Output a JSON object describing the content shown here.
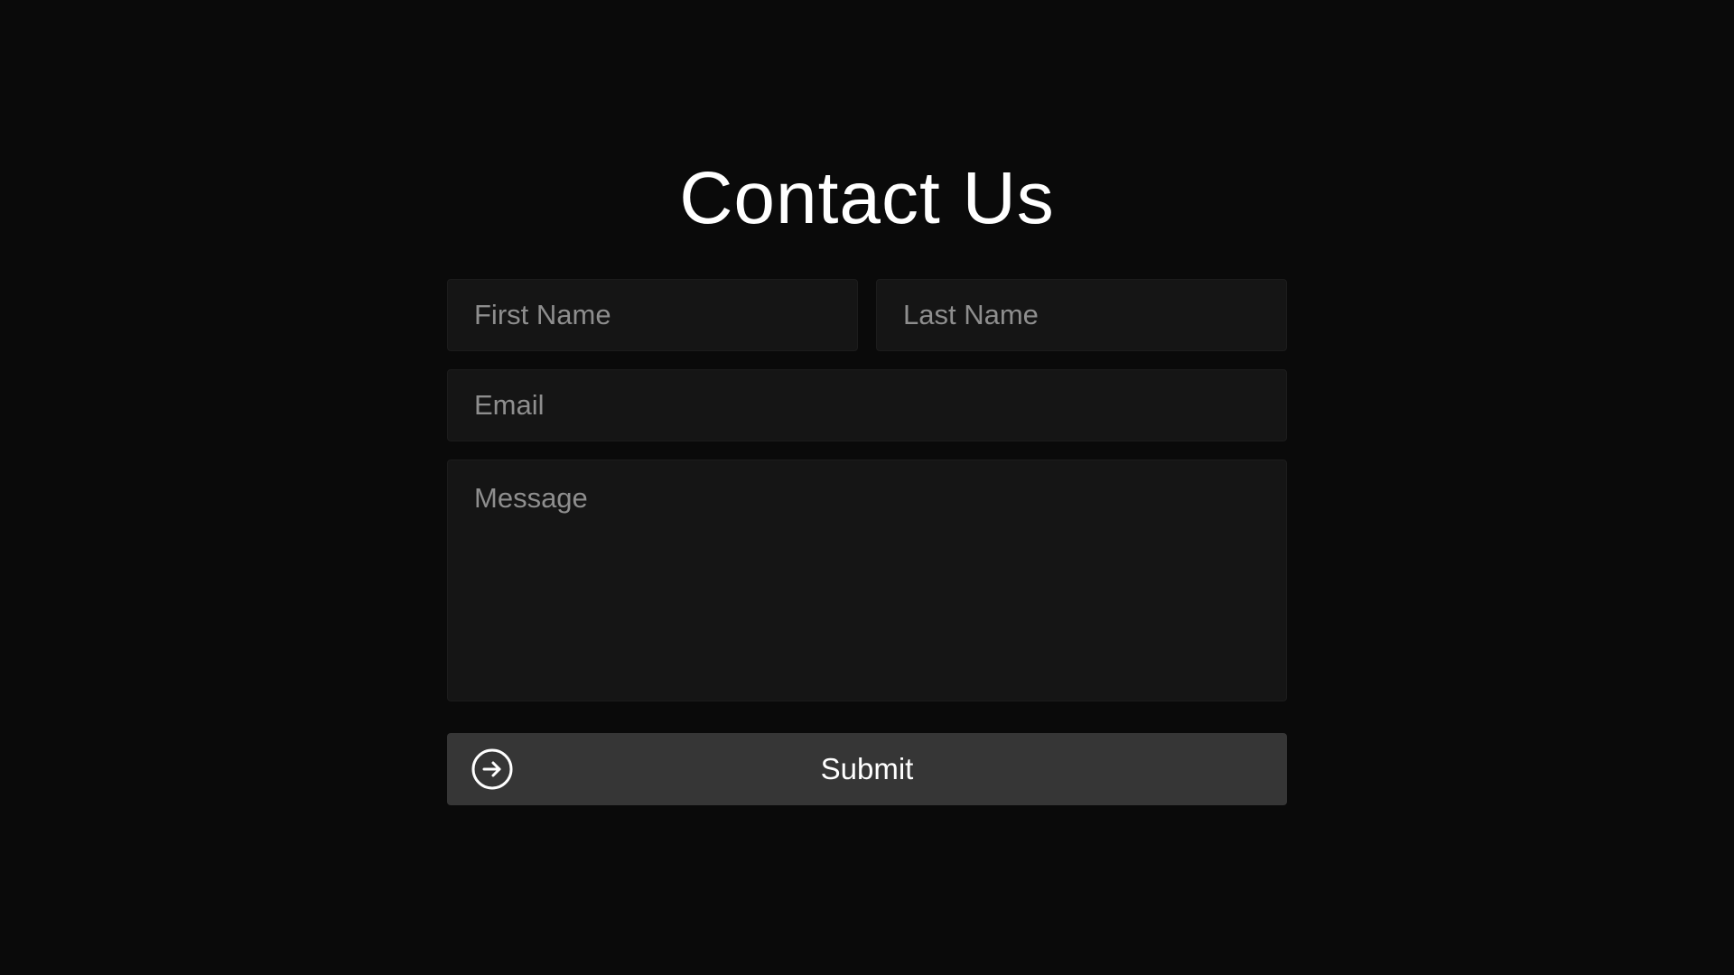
{
  "page": {
    "title": "Contact Us"
  },
  "form": {
    "first_name": {
      "placeholder": "First Name",
      "value": ""
    },
    "last_name": {
      "placeholder": "Last Name",
      "value": ""
    },
    "email": {
      "placeholder": "Email",
      "value": ""
    },
    "message": {
      "placeholder": "Message",
      "value": ""
    },
    "submit": {
      "label": "Submit",
      "icon": "arrow-right-circle-icon"
    }
  },
  "colors": {
    "background": "#0a0a0a",
    "field_background": "#151515",
    "button_background": "#363636",
    "text": "#ffffff",
    "placeholder": "#8e8e8e"
  }
}
